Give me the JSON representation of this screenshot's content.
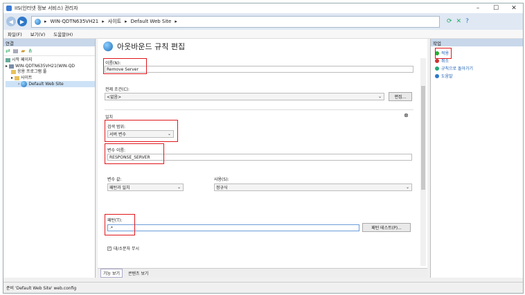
{
  "window": {
    "title": "IIS(인터넷 정보 서비스) 관리자",
    "min": "–",
    "max": "☐",
    "close": "✕"
  },
  "address": {
    "crumbs": [
      "WIN-QDTN635VH21",
      "사이트",
      "Default Web Site"
    ],
    "sep": "▸"
  },
  "menu": [
    "파일(F)",
    "보기(V)",
    "도움말(H)"
  ],
  "connections": {
    "title": "연결",
    "tree": [
      "시작 페이지",
      "WIN-QDTN635VH21(WIN-QD",
      "응용 프로그램 풀",
      "사이트",
      "Default Web Site"
    ]
  },
  "editor": {
    "title": "아웃바운드 규칙 편집",
    "name_label": "이름(N):",
    "name_value": "Remove Server",
    "precond_label": "전제 조건(C):",
    "precond_value": "<없음>",
    "edit_btn": "편집...",
    "match_section": "일치",
    "collapse": "⊗",
    "scope_label": "검색 범위:",
    "scope_value": "서버 변수",
    "var_label": "변수 이름:",
    "var_value": "RESPONSE_SERVER",
    "varval_label": "변수 값:",
    "varval_value": "패턴과 일치",
    "using_label": "사용(S):",
    "using_value": "정규식",
    "pattern_label": "패턴(T):",
    "pattern_value": ".*",
    "test_btn": "패턴 테스트(P)...",
    "ignore_case": "대/소문자 무시"
  },
  "tabs": [
    "기능 보기",
    "콘텐츠 보기"
  ],
  "actions": {
    "title": "작업",
    "items": [
      "적용",
      "취소",
      "규칙으로 돌아가기",
      "도움말"
    ]
  },
  "status": "준비 'Default Web Site' web.config"
}
